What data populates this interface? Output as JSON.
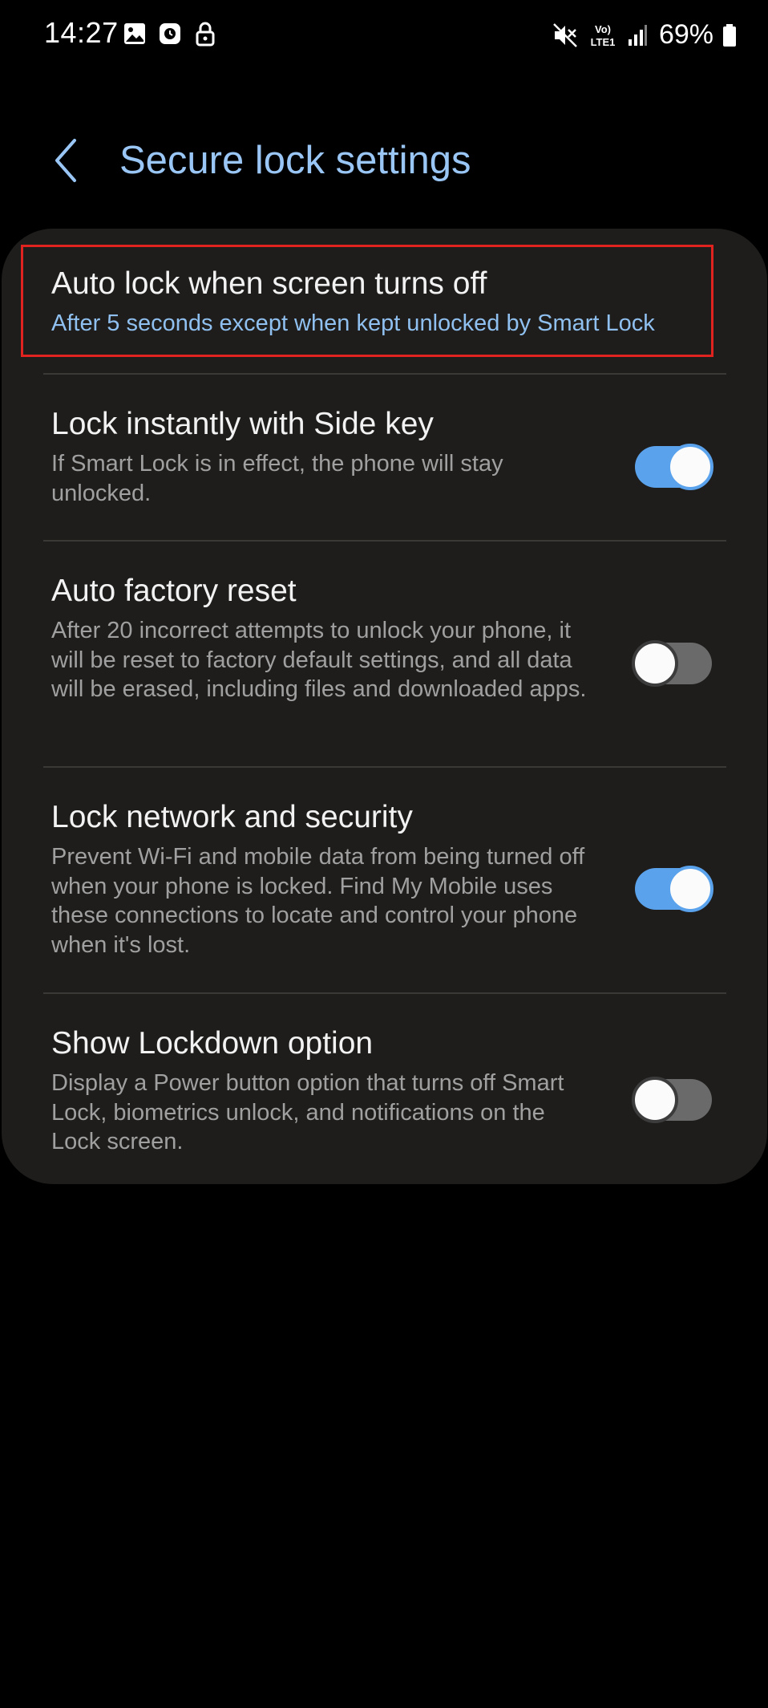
{
  "status_bar": {
    "time": "14:27",
    "left_icons": [
      "gallery-icon",
      "clock-icon",
      "lock-icon"
    ],
    "right_icons": [
      "mute-icon",
      "volte-lte1-icon",
      "signal-icon"
    ],
    "network_label_top": "Vo)",
    "network_label_bottom": "LTE1",
    "battery_percent": "69%"
  },
  "header": {
    "title": "Secure lock settings"
  },
  "settings": {
    "items": [
      {
        "title": "Auto lock when screen turns off",
        "subtitle": "After 5 seconds except when kept unlocked by Smart Lock",
        "highlighted": true
      },
      {
        "title": "Lock instantly with Side key",
        "subtitle": "If Smart Lock is in effect, the phone will stay unlocked.",
        "toggle": true
      },
      {
        "title": "Auto factory reset",
        "subtitle": "After 20 incorrect attempts to unlock your phone, it will be reset to factory default settings, and all data will be erased, including files and downloaded apps.",
        "toggle": false
      },
      {
        "title": "Lock network and security",
        "subtitle": "Prevent Wi-Fi and mobile data from being turned off when your phone is locked. Find My Mobile uses these connections to locate and control your phone when it's lost.",
        "toggle": true
      },
      {
        "title": "Show Lockdown option",
        "subtitle": "Display a Power button option that turns off Smart Lock, biometrics unlock, and notifications on the Lock screen.",
        "toggle": false
      }
    ]
  },
  "colors": {
    "background": "#000000",
    "card": "#1e1d1b",
    "accent": "#9ac6f5",
    "toggle_on": "#5aa2ec",
    "toggle_off": "#6a6a6a",
    "highlight_border": "#e0231f"
  }
}
